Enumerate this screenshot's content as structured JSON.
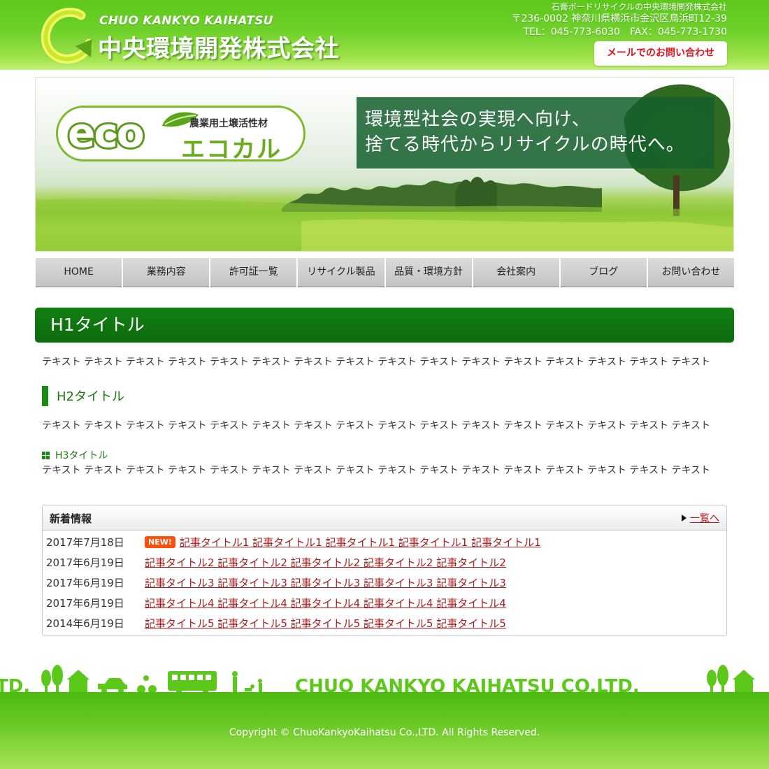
{
  "header": {
    "logo_en": "CHUO KANKYO KAIHATSU",
    "logo_ja": "中央環境開発株式会社",
    "tagline": "石膏ボードリサイクルの中央環境開発株式会社",
    "address": "〒236-0002 神奈川県横浜市金沢区鳥浜町12-39",
    "tel_fax": "TEL：045-773-6030　FAX：045-773-1730",
    "mail_button": "メールでのお問い合わせ"
  },
  "hero": {
    "eco_word": "eco",
    "eco_sub": "農業用土壌活性材",
    "eco_name": "エコカル",
    "catch_line1": "環境型社会の実現へ向け、",
    "catch_line2": "捨てる時代からリサイクルの時代へ。"
  },
  "nav": {
    "items": [
      "HOME",
      "業務内容",
      "許可証一覧",
      "リサイクル製品",
      "品質・環境方針",
      "会社案内",
      "ブログ",
      "お問い合わせ"
    ]
  },
  "content": {
    "h1": "H1タイトル",
    "text1": "テキスト テキスト テキスト テキスト テキスト テキスト テキスト テキスト テキスト テキスト テキスト テキスト テキスト テキスト テキスト テキスト",
    "h2": "H2タイトル",
    "text2": "テキスト テキスト テキスト テキスト テキスト テキスト テキスト テキスト テキスト テキスト テキスト テキスト テキスト テキスト テキスト テキスト",
    "h3": "H3タイトル",
    "text3": "テキスト テキスト テキスト テキスト テキスト テキスト テキスト テキスト テキスト テキスト テキスト テキスト テキスト テキスト テキスト テキスト"
  },
  "news": {
    "title": "新着情報",
    "more_link": "一覧へ",
    "new_badge": "NEW!",
    "items": [
      {
        "date": "2017年7月18日",
        "title": "記事タイトル1 記事タイトル1 記事タイトル1 記事タイトル1 記事タイトル1",
        "is_new": true
      },
      {
        "date": "2017年6月19日",
        "title": "記事タイトル2 記事タイトル2 記事タイトル2 記事タイトル2 記事タイトル2",
        "is_new": false
      },
      {
        "date": "2017年6月19日",
        "title": "記事タイトル3 記事タイトル3 記事タイトル3 記事タイトル3 記事タイトル3",
        "is_new": false
      },
      {
        "date": "2017年6月19日",
        "title": "記事タイトル4 記事タイトル4 記事タイトル4 記事タイトル4 記事タイトル4",
        "is_new": false
      },
      {
        "date": "2014年6月19日",
        "title": "記事タイトル5 記事タイトル5 記事タイトル5 記事タイトル5 記事タイトル5",
        "is_new": false
      }
    ]
  },
  "footer": {
    "band_text": "CHUO KANKYO KAIHATSU CO.LTD.",
    "band_text_partial": "TD.",
    "copyright": "Copyright © ChuoKankyoKaihatsu Co.,LTD. All Rights Reserved."
  },
  "colors": {
    "header_green": "#6fd12a",
    "title_green": "#127f12",
    "mail_red": "#e0121a",
    "link_red": "#a81e1e",
    "new_badge": "#ff4d0a"
  }
}
